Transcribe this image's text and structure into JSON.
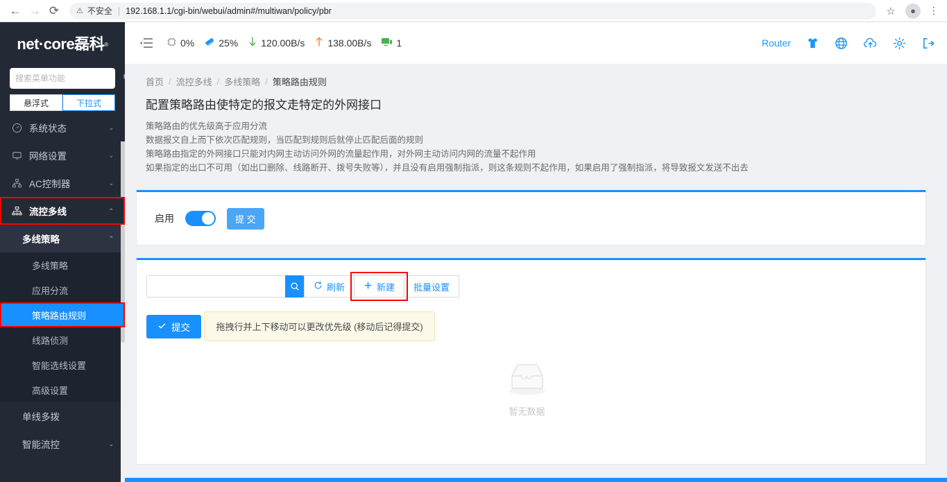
{
  "browser": {
    "back_icon": "back-arrow-icon",
    "forward_icon": "forward-arrow-icon",
    "reload_icon": "reload-icon",
    "security_label": "不安全",
    "url": "192.168.1.1/cgi-bin/webui/admin#/multiwan/policy/pbr",
    "bookmark_icon": "star-icon",
    "profile_icon": "account-icon",
    "menu_icon": "three-dot-menu-icon"
  },
  "sidebar": {
    "brand": "net·core磊科",
    "brand_reg": "®",
    "search_placeholder": "搜索菜单功能",
    "search_value": "",
    "mode_buttons": [
      {
        "label": "悬浮式",
        "active": false
      },
      {
        "label": "下拉式",
        "active": true
      }
    ],
    "menu": [
      {
        "label": "系统状态",
        "icon": "gauge-icon",
        "caret": "⌄"
      },
      {
        "label": "网络设置",
        "icon": "monitor-icon",
        "caret": "⌄"
      },
      {
        "label": "AC控制器",
        "icon": "sitemap-icon",
        "caret": "⌄"
      },
      {
        "label": "流控多线",
        "icon": "network-node-icon",
        "caret": "⌃",
        "highlighted": true
      }
    ],
    "group": {
      "label": "多线策略",
      "caret": "⌃"
    },
    "sub_items": [
      {
        "label": "多线策略",
        "active": false
      },
      {
        "label": "应用分流",
        "active": false
      },
      {
        "label": "策略路由规则",
        "active": true
      },
      {
        "label": "线路侦测",
        "active": false
      },
      {
        "label": "智能选线设置",
        "active": false
      },
      {
        "label": "高级设置",
        "active": false
      }
    ],
    "tail_items": [
      {
        "label": "单线多拨",
        "caret": ""
      },
      {
        "label": "智能流控",
        "caret": "⌄"
      }
    ]
  },
  "topbar": {
    "collapse_icon": "collapse-menu-icon",
    "stats": [
      {
        "icon": "cpu-icon",
        "value": "0%",
        "color": "#8c8c8c"
      },
      {
        "icon": "memory-icon",
        "value": "25%",
        "color": "#2196f3"
      },
      {
        "icon": "download-arrow-icon",
        "value": "120.00B/s",
        "color": "#4caf50"
      },
      {
        "icon": "upload-arrow-icon",
        "value": "138.00B/s",
        "color": "#ff7a29"
      },
      {
        "icon": "device-monitor-icon",
        "value": "1",
        "color": "#4caf50"
      }
    ],
    "router_label": "Router",
    "icons": [
      {
        "name": "tshirt-theme-icon"
      },
      {
        "name": "globe-language-icon"
      },
      {
        "name": "cloud-upload-icon"
      },
      {
        "name": "gear-settings-icon"
      },
      {
        "name": "logout-icon"
      }
    ]
  },
  "page": {
    "breadcrumb": [
      "首页",
      "流控多线",
      "多线策略",
      "策略路由规则"
    ],
    "breadcrumb_sep": "/",
    "title": "配置策略路由使特定的报文走特定的外网接口",
    "description": [
      "策略路由的优先级高于应用分流",
      "数据报文自上而下依次匹配规则，当匹配到规则后就停止匹配后面的规则",
      "策略路由指定的外网接口只能对内网主动访问外网的流量起作用，对外网主动访问内网的流量不起作用",
      "如果指定的出口不可用（如出口删除、线路断开、拨号失败等），并且没有启用强制指派，则这条规则不起作用，如果启用了强制指派，将导致报文发送不出去"
    ]
  },
  "enable_panel": {
    "label": "启用",
    "toggle_on": true,
    "submit_label": "提 交"
  },
  "rules_panel": {
    "search_value": "",
    "search_placeholder": "",
    "search_icon": "search-icon",
    "refresh_label": "刷新",
    "refresh_icon": "refresh-icon",
    "new_label": "新建",
    "new_icon": "plus-icon",
    "batch_label": "批量设置",
    "submit_label": "提交",
    "submit_icon": "check-icon",
    "hint": "拖拽行并上下移动可以更改优先级 (移动后记得提交)",
    "empty_text": "暂无数据",
    "empty_icon": "empty-inbox-icon"
  },
  "colors": {
    "accent": "#1890ff",
    "sidebar_bg": "#242a35",
    "highlight_red": "#ff0000",
    "hint_bg": "#fdf9e8"
  }
}
